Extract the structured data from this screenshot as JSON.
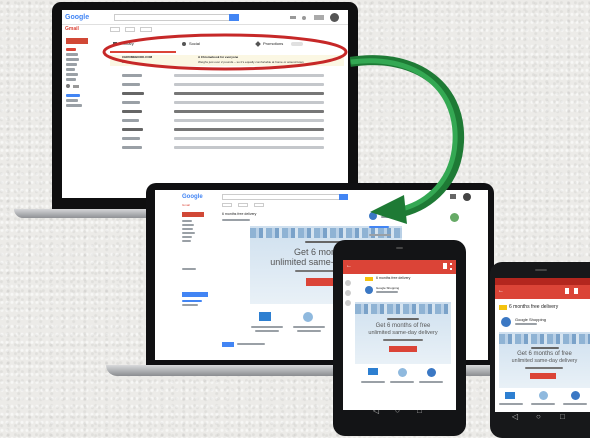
{
  "laptop1": {
    "logo": "Google",
    "mail_label": "Gmail",
    "tabs": [
      "Primary",
      "Social",
      "Promotions"
    ],
    "promo_row": {
      "sender": "CHROMEBOOK.COM",
      "subject": "A Chromebook for everyone",
      "snippet": "Weighs just over 2 pounds – so it's equally comfortable at home or around town"
    }
  },
  "laptop2": {
    "logo": "Google",
    "subject": "6 months free delivery",
    "promo_line1": "Get 6 months of",
    "promo_line2": "unlimited same-day delivery"
  },
  "tablet": {
    "subject": "6 months free delivery",
    "sender": "Google Shopping",
    "promo_line1": "Get 6 months of free",
    "promo_line2": "unlimited same-day delivery"
  },
  "phone": {
    "subject": "6 months free delivery",
    "sender": "Google Shopping",
    "promo_line1": "Get 6 months of free",
    "promo_line2": "unlimited same-day delivery"
  },
  "colors": {
    "highlight_ellipse": "#c62828",
    "arrow": "#1e7a35",
    "gmail_red": "#db4437",
    "google_blue": "#4285f4"
  }
}
